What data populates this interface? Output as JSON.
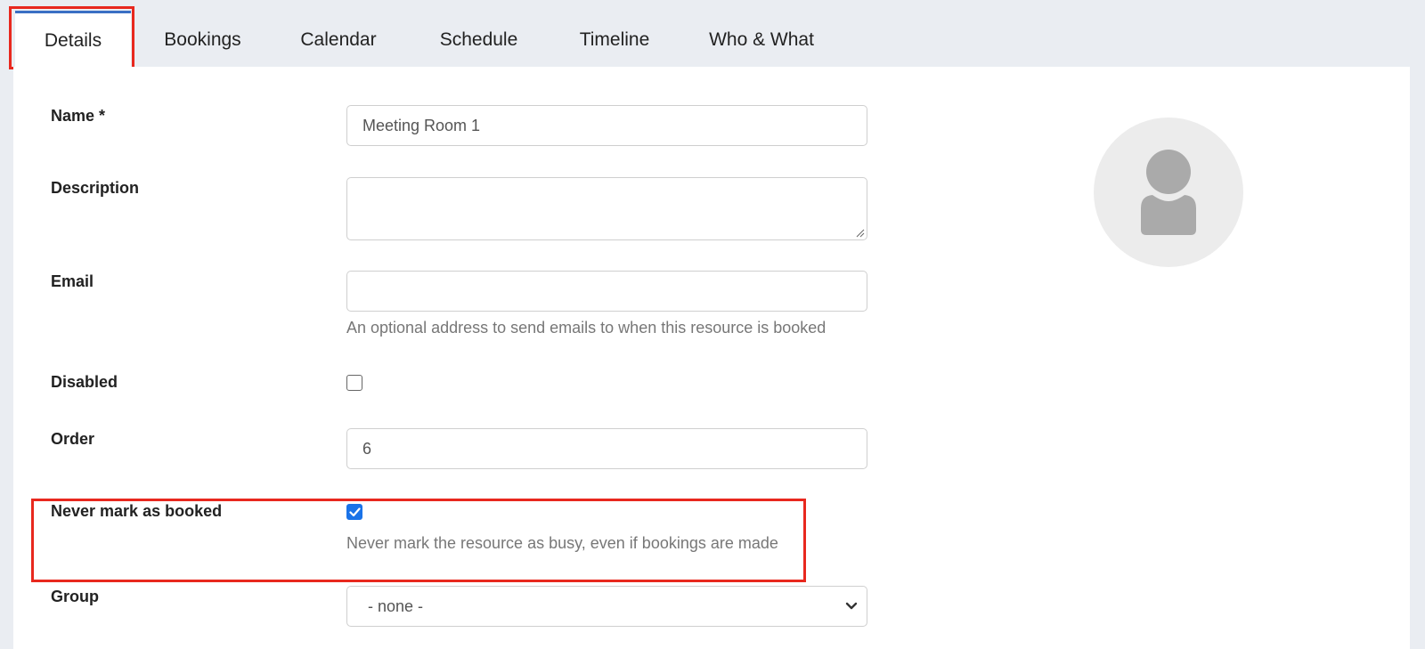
{
  "tabs": [
    {
      "label": "Details",
      "active": true
    },
    {
      "label": "Bookings",
      "active": false
    },
    {
      "label": "Calendar",
      "active": false
    },
    {
      "label": "Schedule",
      "active": false
    },
    {
      "label": "Timeline",
      "active": false
    },
    {
      "label": "Who & What",
      "active": false
    }
  ],
  "form": {
    "name": {
      "label": "Name *",
      "value": "Meeting Room 1"
    },
    "description": {
      "label": "Description",
      "value": ""
    },
    "email": {
      "label": "Email",
      "value": "",
      "help": "An optional address to send emails to when this resource is booked"
    },
    "disabled": {
      "label": "Disabled",
      "checked": false
    },
    "order": {
      "label": "Order",
      "value": "6"
    },
    "never_mark_as_booked": {
      "label": "Never mark as booked",
      "checked": true,
      "help": "Never mark the resource as busy, even if bookings are made"
    },
    "group": {
      "label": "Group",
      "selected": "- none -"
    }
  },
  "avatar": {
    "icon": "user-placeholder-icon"
  },
  "colors": {
    "accent": "#3a6fc4",
    "checkbox_checked": "#1a73e8",
    "highlight": "#e8281e",
    "background": "#eaedf2"
  }
}
